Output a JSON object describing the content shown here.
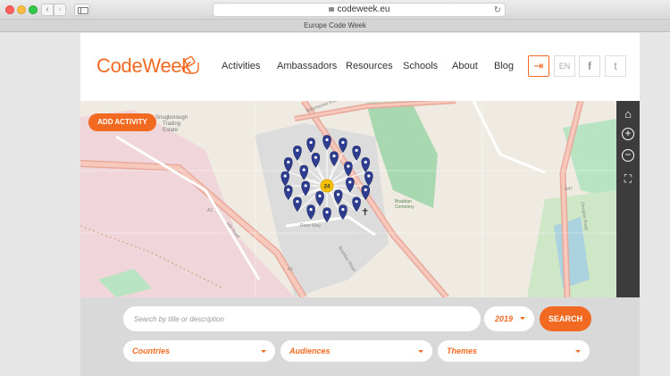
{
  "browser": {
    "url": "codeweek.eu",
    "tab_title": "Europe Code Week",
    "back_glyph": "‹",
    "forward_glyph": "›",
    "reload_glyph": "↻"
  },
  "header": {
    "logo_text": "CodeWeek",
    "nav": [
      {
        "label": "Activities"
      },
      {
        "label": "Ambassadors"
      },
      {
        "label": "Resources"
      },
      {
        "label": "Schools"
      },
      {
        "label": "About"
      },
      {
        "label": "Blog"
      }
    ],
    "login_glyph": "⇥",
    "language": "EN",
    "facebook_glyph": "f",
    "twitter_glyph": "t"
  },
  "map": {
    "add_activity_label": "ADD ACTIVITY",
    "cluster_count": "24",
    "home_glyph": "⌂",
    "zoom_in_glyph": "+",
    "zoom_out_glyph": "−",
    "fullscreen_glyph": "⛶",
    "labels": {
      "area1": "Snugborough",
      "area2": "Trading",
      "area3": "Estate",
      "road1": "Ballyhacket Road",
      "road2": "River Way",
      "park1": "Braddan",
      "park2": "Cemetery",
      "road3": "A1",
      "road4": "A47",
      "road5": "A1",
      "road6": "Mill Road",
      "road7": "Braddan Road",
      "road8": "Douglas Road"
    }
  },
  "search": {
    "placeholder": "Search by title or description",
    "year": "2019",
    "button_label": "SEARCH",
    "filters": [
      {
        "label": "Countries"
      },
      {
        "label": "Audiences"
      },
      {
        "label": "Themes"
      }
    ]
  },
  "colors": {
    "brand_orange": "#f26a21",
    "pin_blue": "#2e3d8f",
    "cluster_yellow": "#f5c000"
  }
}
